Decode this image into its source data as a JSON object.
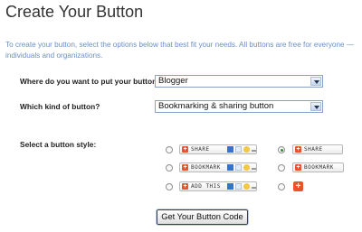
{
  "page": {
    "title": "Create Your Button",
    "intro": "To create your button, select the options below that best fit your needs. All buttons are free for everyone — individuals and organizations."
  },
  "form": {
    "placement_label": "Where do you want to put your button?",
    "placement_value": "Blogger",
    "kind_label": "Which kind of button?",
    "kind_value": "Bookmarking & sharing button",
    "style_label": "Select a button style:",
    "styles": [
      {
        "text": "SHARE",
        "selected": false
      },
      {
        "text": "SHARE",
        "selected": true
      },
      {
        "text": "BOOKMARK",
        "selected": false
      },
      {
        "text": "BOOKMARK",
        "selected": false
      },
      {
        "text": "ADD THIS",
        "selected": false
      },
      {
        "text": "+",
        "selected": false
      }
    ],
    "submit_label": "Get Your Button Code"
  },
  "colors": {
    "intro_text": "#6b8fc6",
    "addthis_orange": "#e8542a"
  }
}
